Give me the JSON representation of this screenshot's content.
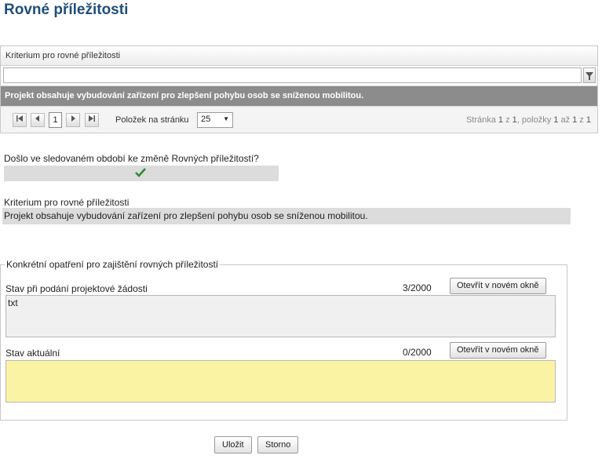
{
  "page": {
    "title": "Rovné příležitosti"
  },
  "grid": {
    "column_header": "Kriterium pro rovné příležitosti",
    "filter_value": "",
    "rows": [
      {
        "criterion": "Projekt obsahuje vybudování zařízení pro zlepšení pohybu osob se sníženou mobilitou."
      }
    ],
    "pager": {
      "first_icon": "first-page-icon",
      "prev_icon": "prev-page-icon",
      "next_icon": "next-page-icon",
      "last_icon": "last-page-icon",
      "current_page": "1",
      "items_per_page_label": "Položek na stránku",
      "items_per_page": "25",
      "info_prefix": "Stránka ",
      "info_page": "1",
      "info_of": " z ",
      "info_pages": "1",
      "info_items": ", položky ",
      "info_from": "1",
      "info_to_word": " až ",
      "info_to": "1",
      "info_total_word": " z ",
      "info_total": "1"
    }
  },
  "question": {
    "label": "Došlo ve sledovaném období ke změně Rovných příležitostí?",
    "answer_icon": "checkmark-icon"
  },
  "criterion_detail": {
    "label": "Kriterium pro rovné příležitosti",
    "value": "Projekt obsahuje vybudování zařízení pro zlepšení pohybu osob se sníženou mobilitou."
  },
  "measures": {
    "legend": "Konkrétní opatření pro zajištění rovných příležitostí",
    "initial": {
      "label": "Stav při podání projektové žádosti",
      "count": "3/2000",
      "button": "Otevřít v novém okně",
      "value": "txt"
    },
    "current": {
      "label": "Stav aktuální",
      "count": "0/2000",
      "button": "Otevřít v novém okně",
      "value": ""
    }
  },
  "actions": {
    "save": "Uložit",
    "cancel": "Storno"
  },
  "colors": {
    "title": "#1f4e79",
    "selected_row": "#8c8c8c",
    "required_field": "#fbf3a4",
    "check": "#2e8b2e"
  }
}
